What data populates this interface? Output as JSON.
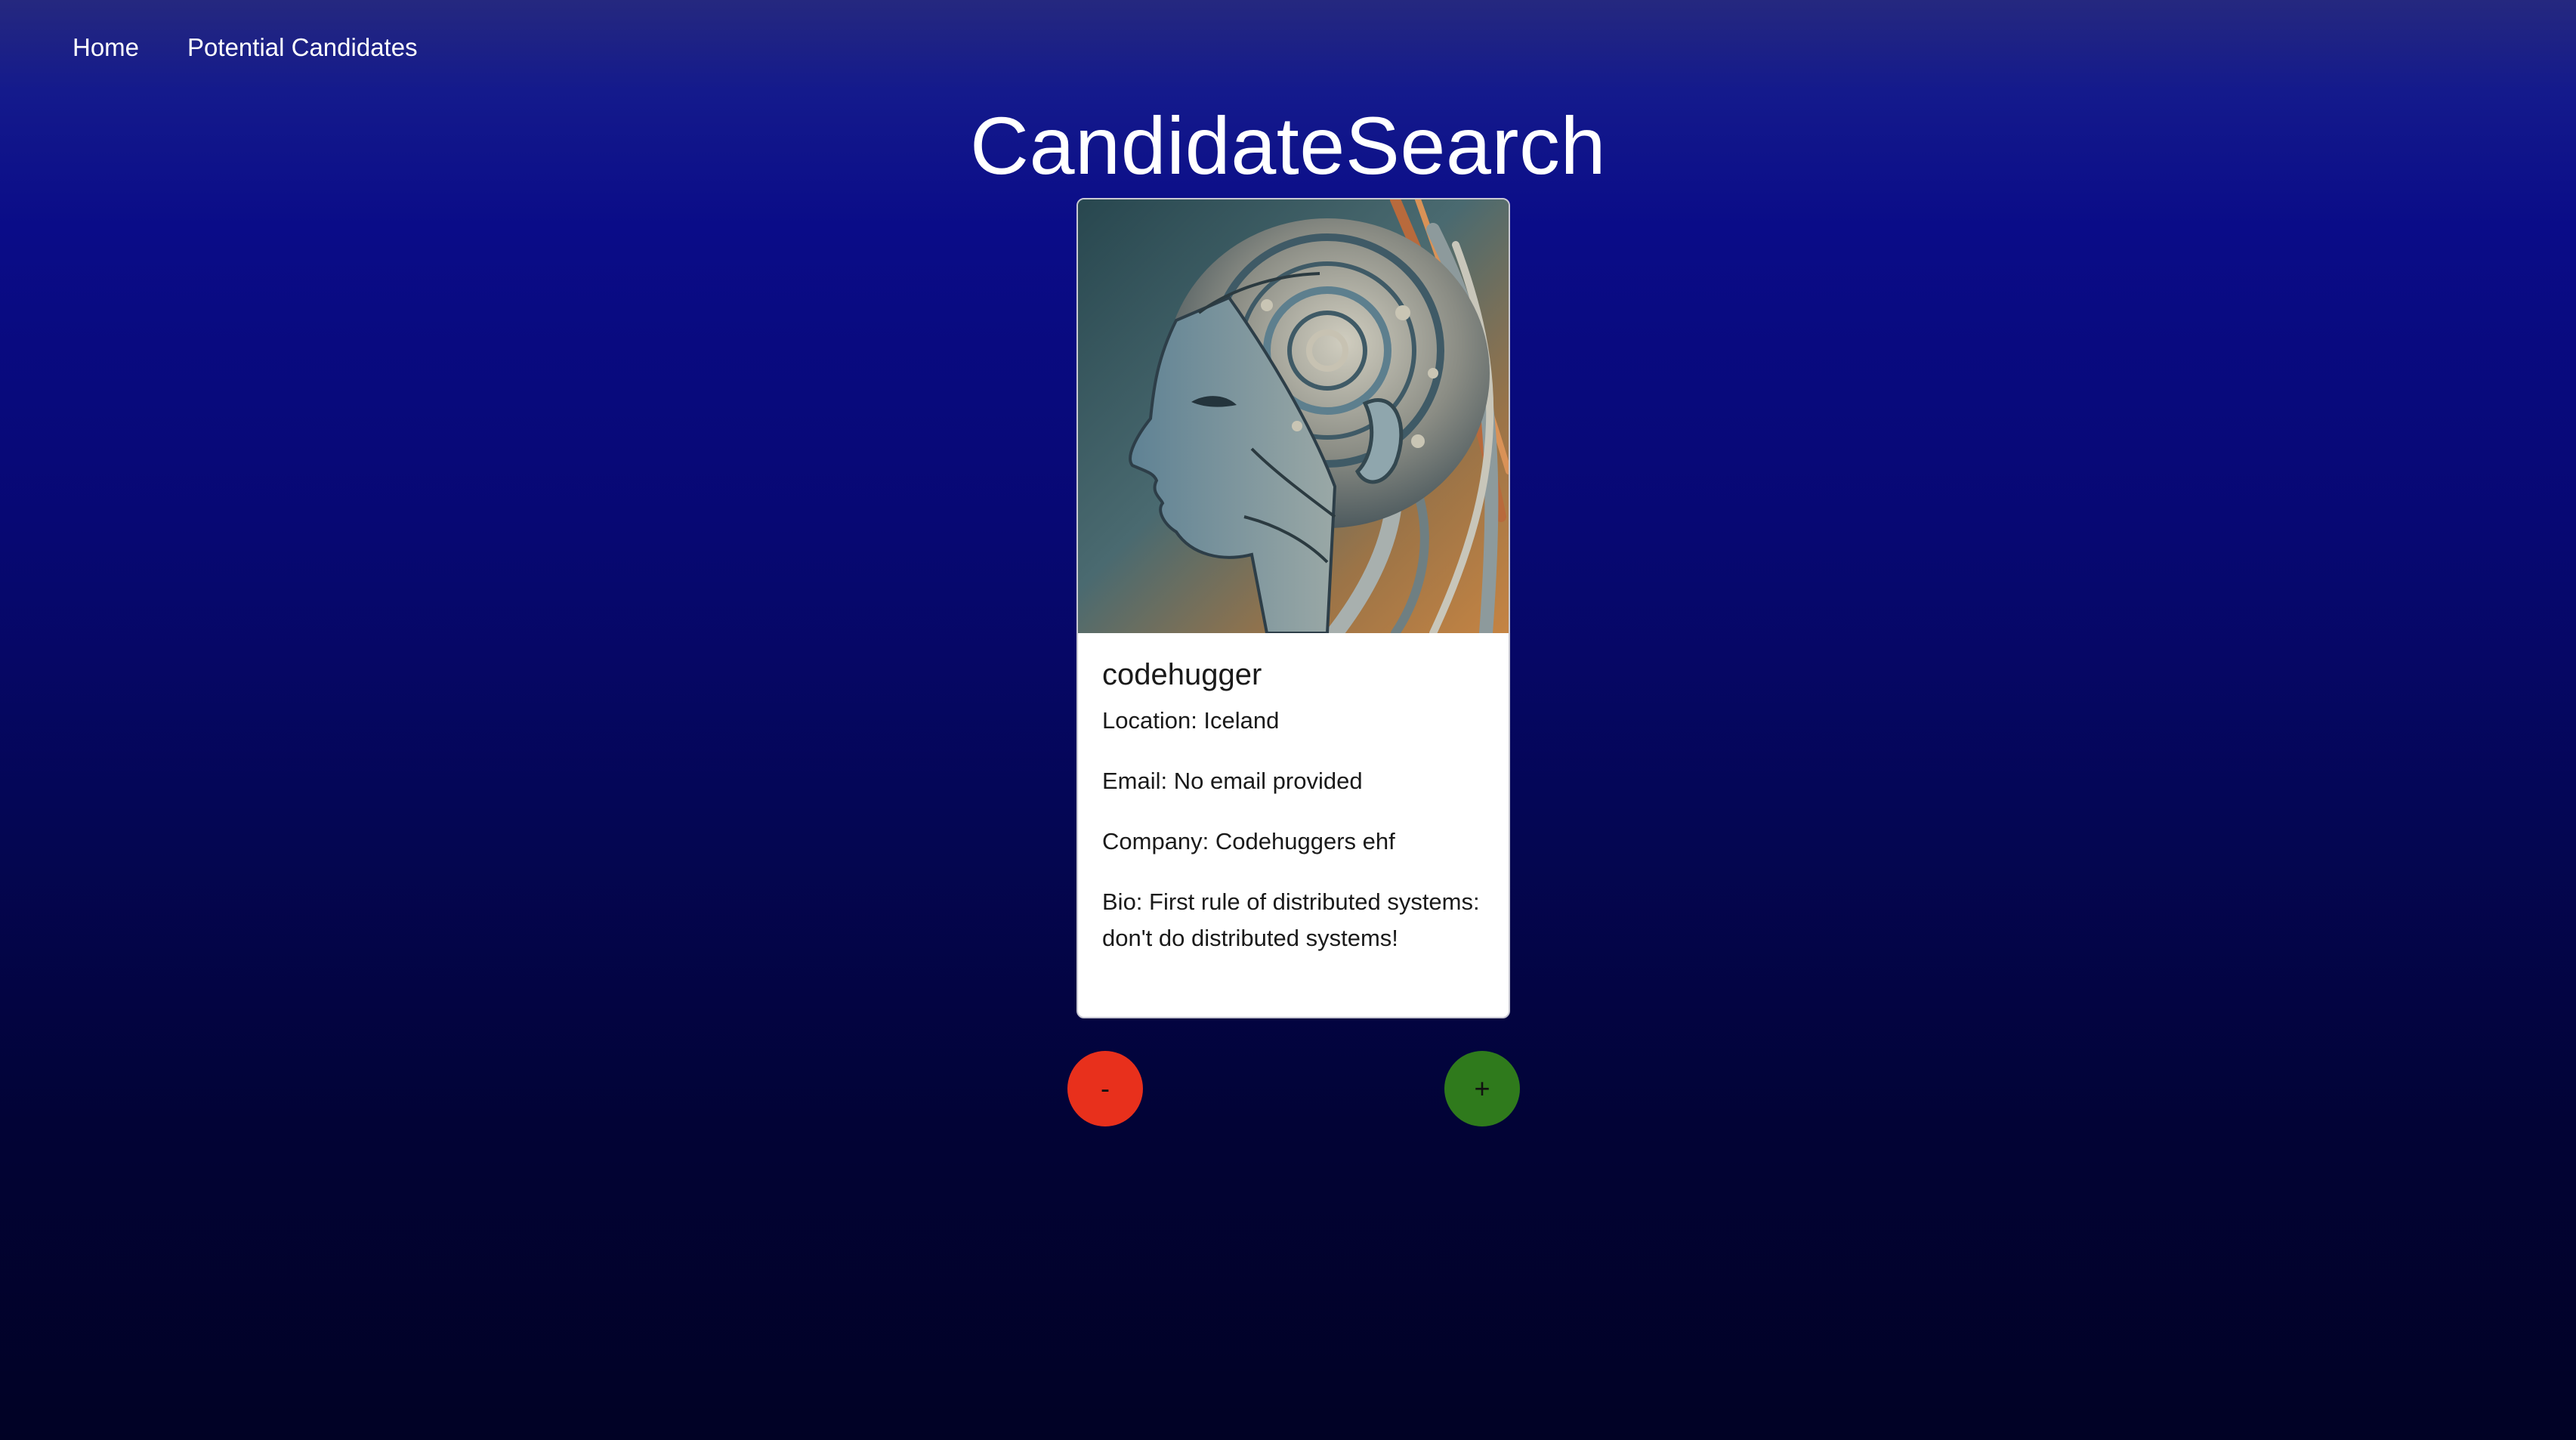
{
  "nav": {
    "items": [
      {
        "label": "Home"
      },
      {
        "label": "Potential Candidates"
      }
    ]
  },
  "page": {
    "title": "CandidateSearch"
  },
  "candidate": {
    "avatar_icon": "robot-head-portrait-icon",
    "name": "codehugger",
    "location": "Location: Iceland",
    "email": "Email: No email provided",
    "company": "Company: Codehuggers ehf",
    "bio": "Bio: First rule of distributed systems: don't do distributed systems!"
  },
  "actions": {
    "reject_label": "-",
    "accept_label": "+",
    "reject_color": "#e8301c",
    "accept_color": "#2f7a1c"
  },
  "colors": {
    "background_top": "#25287f",
    "background_bottom": "#010225",
    "card": "#ffffff"
  }
}
